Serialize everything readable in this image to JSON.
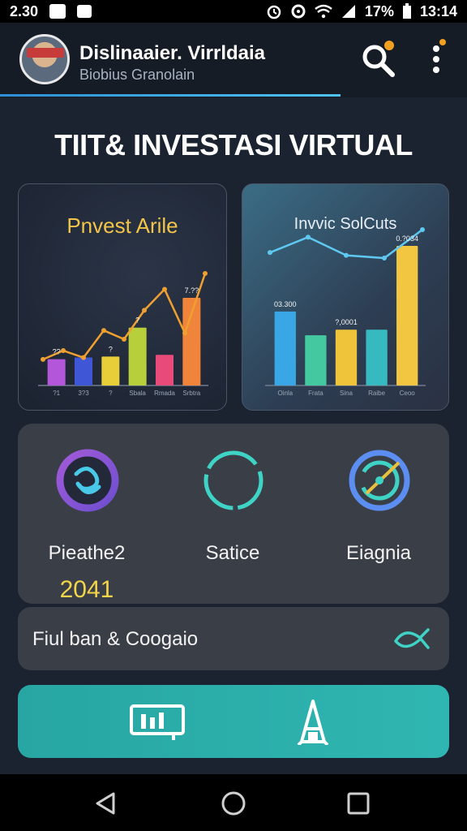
{
  "status_bar": {
    "time_left": "2.30",
    "battery": "17%",
    "time_right": "13:14"
  },
  "header": {
    "title": "Dislinaaier. Virrldaia",
    "subtitle": "Biobius Granolain"
  },
  "page_title": "TIIT& INVESTASI VIRTUAL",
  "charts": {
    "left_title": "Pnvest Arile",
    "right_title": "Invvic SolCuts"
  },
  "chart_data": [
    {
      "type": "bar",
      "title": "Pnvest Arile",
      "categories": [
        "?1",
        "3?3",
        "?",
        "Sbala",
        "Rmada",
        "Srbtra"
      ],
      "values": [
        30,
        32,
        33,
        66,
        35,
        100
      ],
      "colors": [
        "#b356d9",
        "#3f57d6",
        "#e8cf3a",
        "#b7cf3a",
        "#e84b7a",
        "#f0843a"
      ],
      "line": [
        2,
        12,
        4,
        35,
        25,
        58,
        82,
        32,
        100
      ],
      "line_color": "#f0a030",
      "data_labels": [
        {
          "text": "??",
          "series_index": 0
        },
        {
          "text": "?",
          "series_index": 2
        },
        {
          "text": "?",
          "series_index": 3
        },
        {
          "text": "7.??",
          "series_index": 5
        }
      ],
      "ylim": [
        0,
        100
      ]
    },
    {
      "type": "bar",
      "title": "Invvic SolCuts",
      "categories": [
        "Oinla",
        "Frata",
        "Sina",
        "Raibe",
        "Ceoo"
      ],
      "values": [
        53,
        36,
        40,
        40,
        100
      ],
      "colors": [
        "#39a6e6",
        "#44c8a0",
        "#f0c43a",
        "#37b9c0",
        "#f2c640"
      ],
      "line": [
        72,
        83,
        70,
        68,
        120
      ],
      "line_color": "#5fc8f0",
      "data_labels": [
        {
          "text": "03.300",
          "series_index": 0
        },
        {
          "text": "?,0001",
          "series_index": 2
        },
        {
          "text": "0.?034",
          "series_index": 4
        }
      ],
      "ylim": [
        0,
        100
      ]
    }
  ],
  "stats": [
    {
      "label": "Pieathe2",
      "value": "2041",
      "icon": "swirl-ring-icon"
    },
    {
      "label": "Satice",
      "value": "",
      "icon": "ring-icon"
    },
    {
      "label": "Eiagnia",
      "value": "",
      "icon": "gauge-icon"
    }
  ],
  "list_item": {
    "label": "Fiul ban & Coogaio",
    "icon": "fish-icon"
  },
  "action_bar": {
    "left_icon": "chart-board-icon",
    "right_icon": "tower-icon"
  },
  "nav": {
    "back_icon": "back-triangle-icon",
    "home_icon": "home-circle-icon",
    "recents_icon": "recents-square-icon"
  },
  "colors": {
    "accent_teal": "#2fb3b0",
    "value_yellow": "#f3d44a",
    "card_dark": "#3a3f47"
  }
}
